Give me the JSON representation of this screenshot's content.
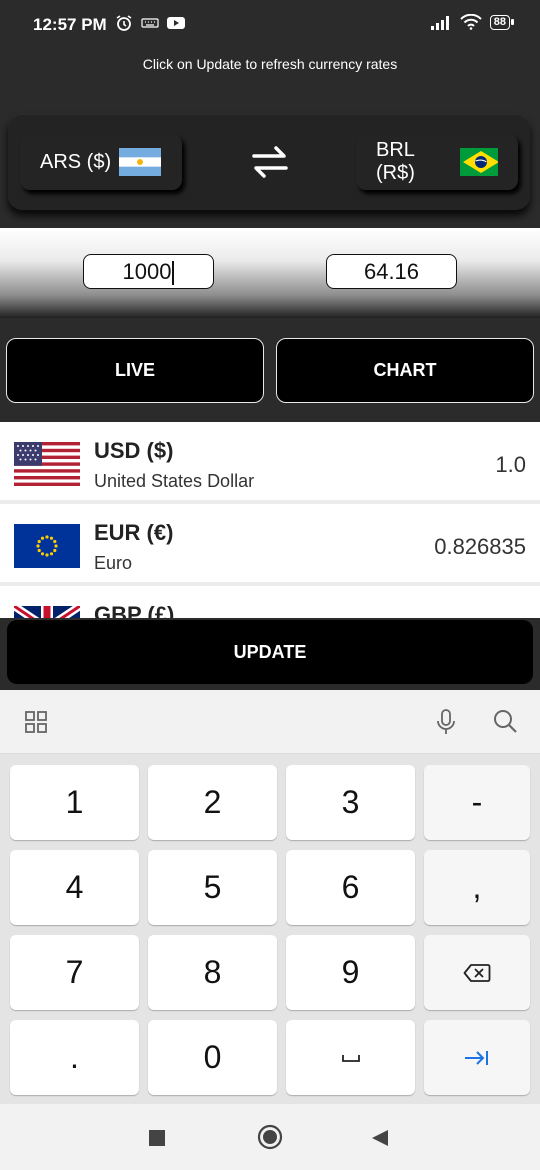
{
  "status": {
    "time": "12:57 PM",
    "battery": "88"
  },
  "hint": "Click on Update to refresh currency rates",
  "converter": {
    "from": {
      "label": "ARS ($)",
      "flag": "argentina-flag"
    },
    "to": {
      "label": "BRL (R$)",
      "flag": "brazil-flag"
    },
    "amount_from": "1000",
    "amount_to": "64.16"
  },
  "tabs": {
    "live": "LIVE",
    "chart": "CHART"
  },
  "rates": [
    {
      "code": "USD ($)",
      "name": "United States Dollar",
      "rate": "1.0",
      "flag": "usa-flag"
    },
    {
      "code": "EUR (€)",
      "name": "Euro",
      "rate": "0.826835",
      "flag": "eu-flag"
    },
    {
      "code": "GBP (£)",
      "name": "",
      "rate": "",
      "flag": "uk-flag"
    }
  ],
  "update_label": "UPDATE",
  "keyboard": {
    "keys": [
      "1",
      "2",
      "3",
      "-",
      "4",
      "5",
      "6",
      ",",
      "7",
      "8",
      "9",
      "backspace",
      ".",
      "0",
      "space",
      "tab"
    ],
    "labels": {
      "k1": "1",
      "k2": "2",
      "k3": "3",
      "dash": "-",
      "k4": "4",
      "k5": "5",
      "k6": "6",
      "comma": ",",
      "k7": "7",
      "k8": "8",
      "k9": "9",
      "dot": ".",
      "k0": "0"
    }
  },
  "colors": {
    "dark_bg": "#2b2b2b",
    "button_black": "#000000",
    "accent_blue": "#1a73e8"
  }
}
